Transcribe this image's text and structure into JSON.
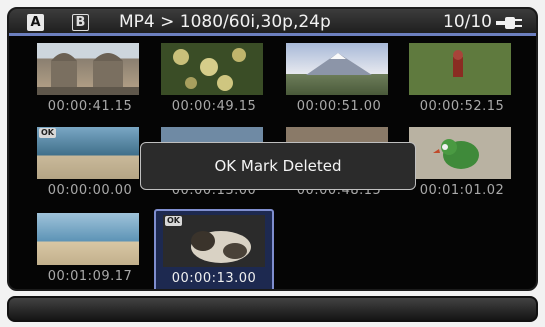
{
  "header": {
    "slot_a": "A",
    "slot_b": "B",
    "format": "MP4 > 1080/60i,30p,24p",
    "counter": "10/10"
  },
  "thumbnails": [
    {
      "time": "00:00:41.15",
      "scene": "palace",
      "ok": ""
    },
    {
      "time": "00:00:49.15",
      "scene": "flowers",
      "ok": ""
    },
    {
      "time": "00:00:51.00",
      "scene": "mountain",
      "ok": ""
    },
    {
      "time": "00:00:52.15",
      "scene": "toy-grass",
      "ok": ""
    },
    {
      "time": "00:00:00.00",
      "scene": "beach",
      "ok": "OK"
    },
    {
      "time": "00:00:13.00",
      "scene": "hidden",
      "ok": ""
    },
    {
      "time": "00:00:48.15",
      "scene": "hidden",
      "ok": ""
    },
    {
      "time": "00:01:01.02",
      "scene": "bird",
      "ok": ""
    },
    {
      "time": "00:01:09.17",
      "scene": "sea",
      "ok": ""
    },
    {
      "time": "00:00:13.00",
      "scene": "cat",
      "ok": "OK"
    }
  ],
  "dialog": {
    "message": "OK Mark Deleted"
  },
  "colors": {
    "accent": "#6c7fbf",
    "selection": "#1d2950"
  }
}
